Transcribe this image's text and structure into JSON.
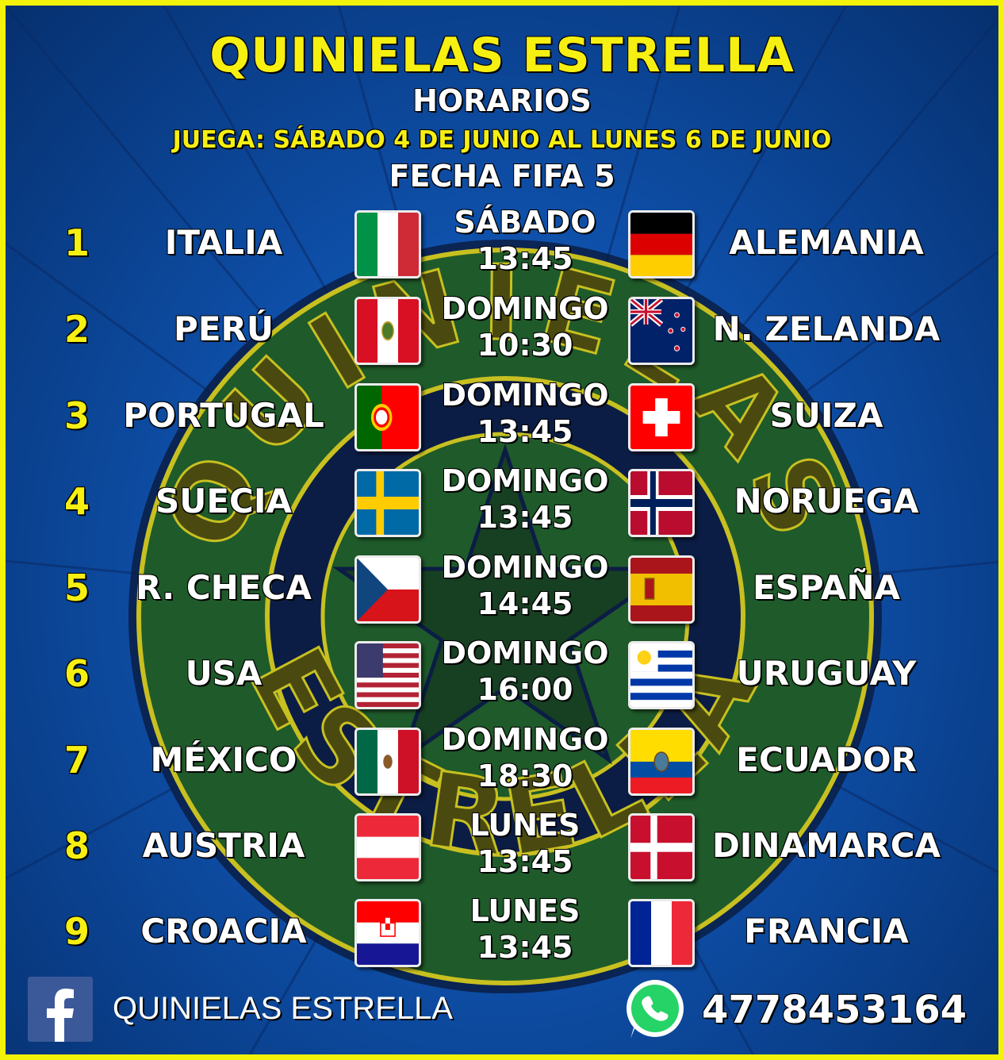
{
  "header": {
    "title": "QUINIELAS ESTRELLA",
    "subtitle": "HORARIOS",
    "dates": "JUEGA: SÁBADO 4 DE JUNIO AL LUNES 6 DE JUNIO",
    "fecha": "FECHA FIFA 5"
  },
  "emblem_text": "QUINIELAS ESTRELLA",
  "matches": [
    {
      "num": "1",
      "home": "ITALIA",
      "home_flag": "italy-flag-icon",
      "day": "SÁBADO",
      "time": "13:45",
      "away": "ALEMANIA",
      "away_flag": "germany-flag-icon"
    },
    {
      "num": "2",
      "home": "PERÚ",
      "home_flag": "peru-flag-icon",
      "day": "DOMINGO",
      "time": "10:30",
      "away": "N. ZELANDA",
      "away_flag": "new-zealand-flag-icon"
    },
    {
      "num": "3",
      "home": "PORTUGAL",
      "home_flag": "portugal-flag-icon",
      "day": "DOMINGO",
      "time": "13:45",
      "away": "SUIZA",
      "away_flag": "switzerland-flag-icon"
    },
    {
      "num": "4",
      "home": "SUECIA",
      "home_flag": "sweden-flag-icon",
      "day": "DOMINGO",
      "time": "13:45",
      "away": "NORUEGA",
      "away_flag": "norway-flag-icon"
    },
    {
      "num": "5",
      "home": "R. CHECA",
      "home_flag": "czech-flag-icon",
      "day": "DOMINGO",
      "time": "14:45",
      "away": "ESPAÑA",
      "away_flag": "spain-flag-icon"
    },
    {
      "num": "6",
      "home": "USA",
      "home_flag": "usa-flag-icon",
      "day": "DOMINGO",
      "time": "16:00",
      "away": "URUGUAY",
      "away_flag": "uruguay-flag-icon"
    },
    {
      "num": "7",
      "home": "MÉXICO",
      "home_flag": "mexico-flag-icon",
      "day": "DOMINGO",
      "time": "18:30",
      "away": "ECUADOR",
      "away_flag": "ecuador-flag-icon"
    },
    {
      "num": "8",
      "home": "AUSTRIA",
      "home_flag": "austria-flag-icon",
      "day": "LUNES",
      "time": "13:45",
      "away": "DINAMARCA",
      "away_flag": "denmark-flag-icon"
    },
    {
      "num": "9",
      "home": "CROACIA",
      "home_flag": "croatia-flag-icon",
      "day": "LUNES",
      "time": "13:45",
      "away": "FRANCIA",
      "away_flag": "france-flag-icon"
    }
  ],
  "footer": {
    "facebook_name": "QUINIELAS ESTRELLA",
    "phone": "4778453164",
    "facebook_icon": "facebook-icon",
    "whatsapp_icon": "whatsapp-icon"
  },
  "colors": {
    "border": "#f2f20a",
    "accent_yellow": "#f6ef12",
    "emblem_green": "#1f5a2a",
    "emblem_navy": "#0b1d45",
    "background_blue": "#0e4fa8"
  }
}
